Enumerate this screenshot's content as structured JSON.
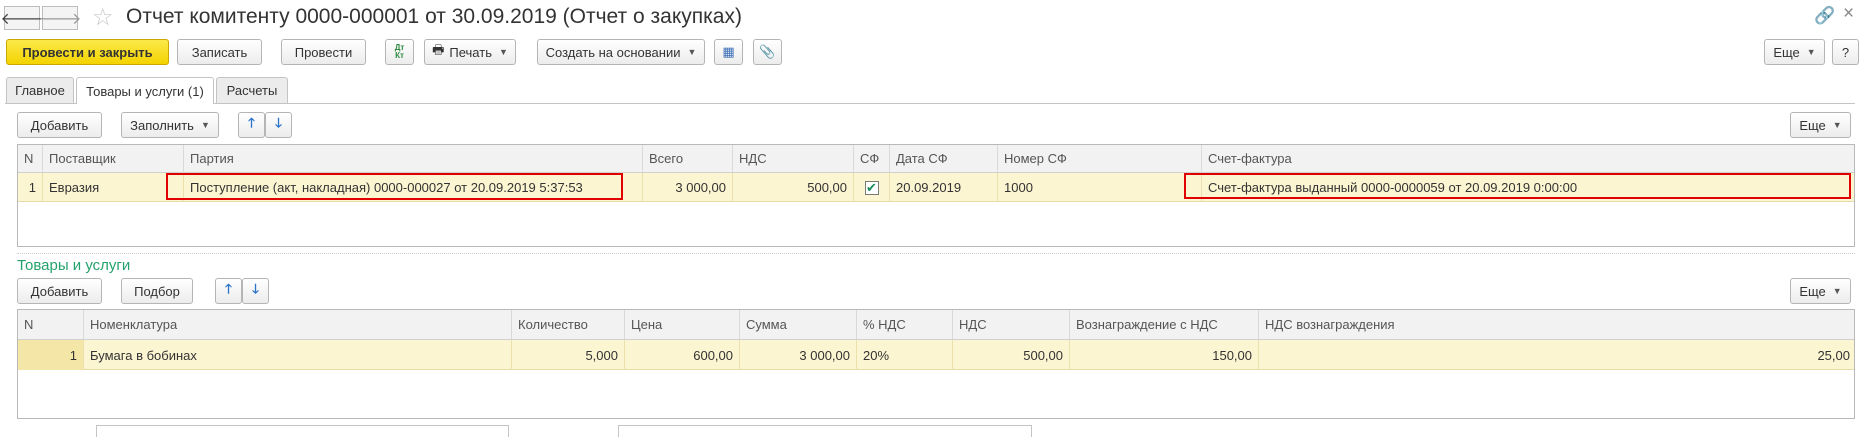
{
  "window": {
    "title": "Отчет комитенту 0000-000001 от 30.09.2019 (Отчет о закупках)",
    "icons": [
      "arrow-left-icon",
      "arrow-right-icon",
      "star-icon",
      "link-icon",
      "close-icon"
    ],
    "link_glyph": "🔗",
    "close_glyph": "×",
    "back_glyph": "🡐",
    "forward_glyph": "🡒",
    "star_glyph": "☆"
  },
  "toolbar": {
    "post_close": "Провести и закрыть",
    "save": "Записать",
    "post": "Провести",
    "dt_kt_glyph": "Дт\nКт",
    "print": "Печать",
    "print_glyph": "🖶",
    "create_based": "Создать на основании",
    "structure_glyph": "▦",
    "attach_glyph": "📎",
    "more": "Еще",
    "help": "?"
  },
  "tabs": [
    {
      "label": "Главное",
      "active": false
    },
    {
      "label": "Товары и услуги (1)",
      "active": true
    },
    {
      "label": "Расчеты",
      "active": false
    }
  ],
  "batches": {
    "toolbar": {
      "add": "Добавить",
      "fill": "Заполнить",
      "up_glyph": "🡑",
      "down_glyph": "🡓",
      "more": "Еще"
    },
    "columns": [
      "N",
      "Поставщик",
      "Партия",
      "Всего",
      "НДС",
      "СФ",
      "Дата СФ",
      "Номер СФ",
      "Счет-фактура"
    ],
    "rows": [
      {
        "n": "1",
        "supplier": "Евразия",
        "batch": "Поступление (акт, накладная) 0000-000027 от 20.09.2019 5:37:53",
        "total": "3 000,00",
        "vat": "500,00",
        "sf": true,
        "sf_check_glyph": "✔",
        "sf_date": "20.09.2019",
        "sf_number": "1000",
        "invoice": "Счет-фактура выданный 0000-0000059 от 20.09.2019 0:00:00"
      }
    ]
  },
  "goods": {
    "section_title": "Товары и услуги",
    "toolbar": {
      "add": "Добавить",
      "pick": "Подбор",
      "up_glyph": "🡑",
      "down_glyph": "🡓",
      "more": "Еще"
    },
    "columns": [
      "N",
      "Номенклатура",
      "Количество",
      "Цена",
      "Сумма",
      "% НДС",
      "НДС",
      "Вознаграждение с НДС",
      "НДС вознаграждения"
    ],
    "rows": [
      {
        "n": "1",
        "item": "Бумага в бобинах",
        "qty": "5,000",
        "price": "600,00",
        "sum": "3 000,00",
        "vat_rate": "20%",
        "vat": "500,00",
        "fee": "150,00",
        "fee_vat": "25,00"
      }
    ]
  },
  "colors": {
    "accent_green": "#23a36b",
    "primary_yellow": "#f3d300",
    "row_highlight": "#fcf5d1",
    "marker_red": "#e00000"
  }
}
